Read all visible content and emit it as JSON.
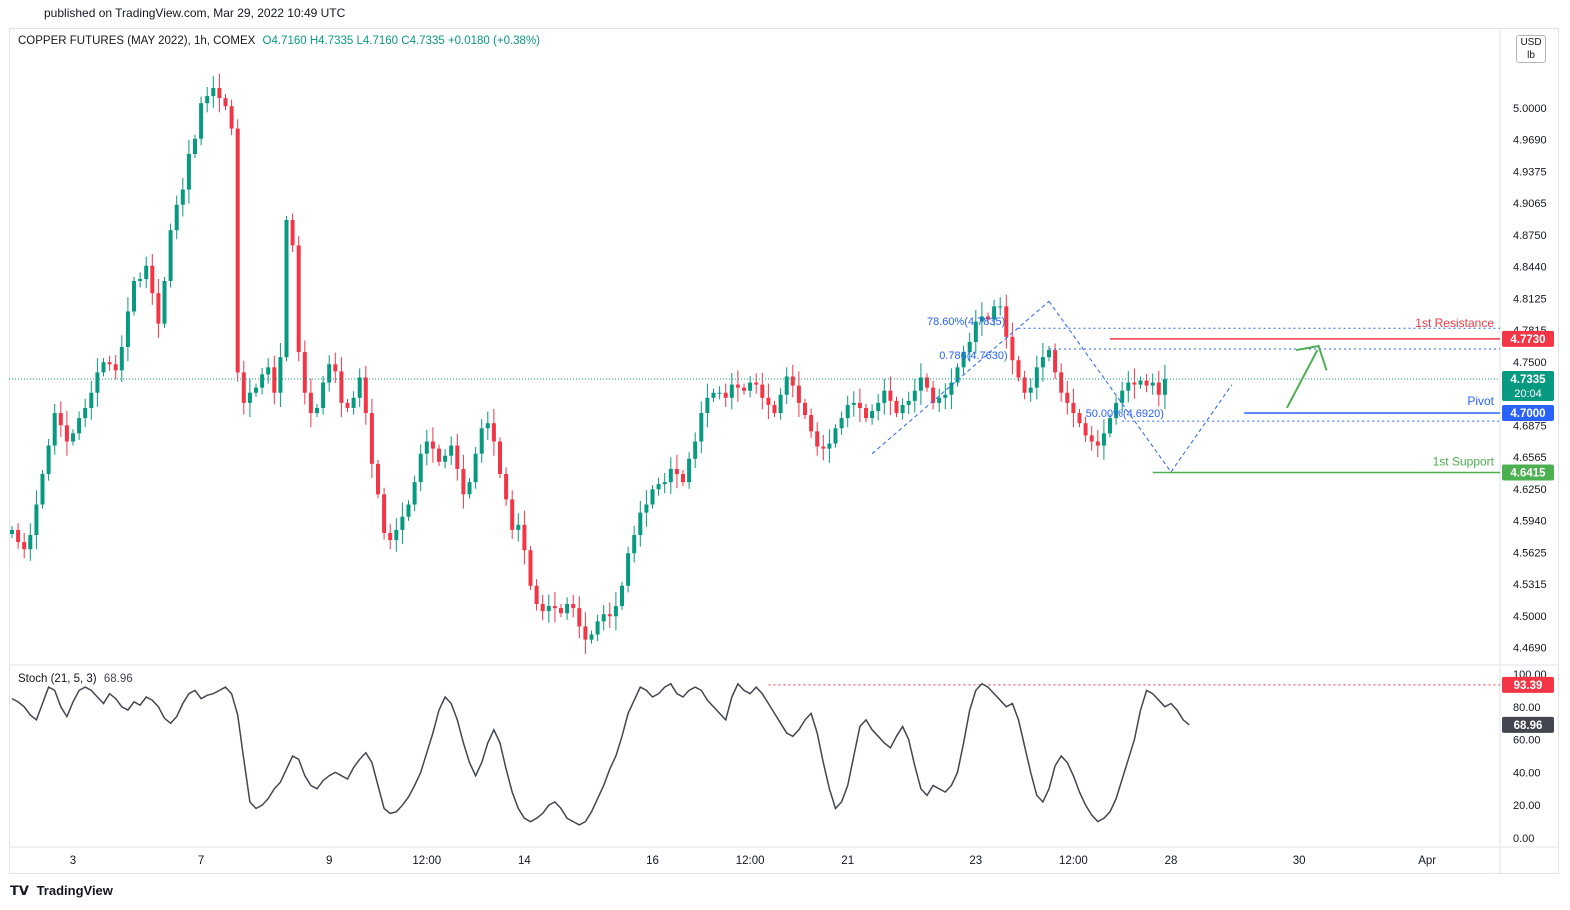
{
  "header": {
    "published": "published on TradingView.com, Mar 29, 2022 10:49 UTC"
  },
  "legend": {
    "symbol": "COPPER FUTURES (MAY 2022), 1h, COMEX",
    "ohlc": "O4.7160  H4.7335  L4.7160  C4.7335  +0.0180 (+0.38%)"
  },
  "units": {
    "currency": "USD",
    "unit": "lb"
  },
  "stoch_legend": {
    "label": "Stoch (21, 5, 3)",
    "value": "68.96"
  },
  "footer": {
    "brand": "TradingView",
    "logo_icon": "tradingview-logo-icon"
  },
  "colors": {
    "up": "#089981",
    "down": "#f23645",
    "resistance": "#f23645",
    "pivot": "#2962ff",
    "support": "#4caf50",
    "stoch": "#434651"
  },
  "chart_data": [
    {
      "type": "candlestick",
      "title": "COPPER FUTURES (MAY 2022), 1h, COMEX",
      "ylim": [
        4.453,
        5.078
      ],
      "price_ticks": [
        "5.0000",
        "4.9690",
        "4.9375",
        "4.9065",
        "4.8750",
        "4.8440",
        "4.8125",
        "4.7815",
        "4.7500",
        "4.6875",
        "4.6565",
        "4.6250",
        "4.5940",
        "4.5625",
        "4.5315",
        "4.5000",
        "4.4690"
      ],
      "x_ticks": [
        {
          "label": "3",
          "i": 10
        },
        {
          "label": "7",
          "i": 31
        },
        {
          "label": "9",
          "i": 52
        },
        {
          "label": "12:00",
          "i": 68
        },
        {
          "label": "14",
          "i": 84
        },
        {
          "label": "16",
          "i": 105
        },
        {
          "label": "12:00",
          "i": 121
        },
        {
          "label": "21",
          "i": 137
        },
        {
          "label": "23",
          "i": 158
        },
        {
          "label": "12:00",
          "i": 174
        },
        {
          "label": "28",
          "i": 190
        },
        {
          "label": "30",
          "i": 211
        },
        {
          "label": "Apr",
          "i": 232
        }
      ],
      "series_close": [
        4.585,
        4.573,
        4.566,
        4.58,
        4.61,
        4.64,
        4.668,
        4.7,
        4.688,
        4.672,
        4.68,
        4.695,
        4.705,
        4.72,
        4.74,
        4.75,
        4.748,
        4.742,
        4.765,
        4.8,
        4.83,
        4.832,
        4.845,
        4.818,
        4.788,
        4.83,
        4.88,
        4.905,
        4.92,
        4.955,
        4.97,
        5.005,
        5.012,
        5.02,
        5.01,
        5.002,
        4.98,
        4.74,
        4.71,
        4.72,
        4.725,
        4.738,
        4.745,
        4.72,
        4.755,
        4.89,
        4.865,
        4.76,
        4.72,
        4.7,
        4.705,
        4.73,
        4.748,
        4.741,
        4.71,
        4.705,
        4.715,
        4.735,
        4.7,
        4.65,
        4.62,
        4.582,
        4.575,
        4.585,
        4.598,
        4.61,
        4.632,
        4.66,
        4.672,
        4.665,
        4.652,
        4.658,
        4.668,
        4.645,
        4.62,
        4.632,
        4.66,
        4.685,
        4.69,
        4.672,
        4.64,
        4.615,
        4.585,
        4.59,
        4.565,
        4.53,
        4.512,
        4.505,
        4.51,
        4.508,
        4.503,
        4.512,
        4.508,
        4.49,
        4.477,
        4.482,
        4.495,
        4.502,
        4.5,
        4.51,
        4.53,
        4.562,
        4.58,
        4.602,
        4.61,
        4.625,
        4.63,
        4.632,
        4.645,
        4.64,
        4.632,
        4.655,
        4.672,
        4.7,
        4.715,
        4.72,
        4.72,
        4.715,
        4.728,
        4.725,
        4.722,
        4.73,
        4.728,
        4.715,
        4.708,
        4.7,
        4.718,
        4.736,
        4.727,
        4.71,
        4.698,
        4.682,
        4.667,
        4.665,
        4.67,
        4.685,
        4.695,
        4.708,
        4.71,
        4.705,
        4.695,
        4.702,
        4.71,
        4.722,
        4.712,
        4.7,
        4.708,
        4.712,
        4.722,
        4.735,
        4.725,
        4.71,
        4.715,
        4.718,
        4.73,
        4.745,
        4.76,
        4.77,
        4.79,
        4.795,
        4.792,
        4.805,
        4.805,
        4.775,
        4.752,
        4.735,
        4.72,
        4.725,
        4.745,
        4.755,
        4.762,
        4.74,
        4.72,
        4.71,
        4.7,
        4.69,
        4.678,
        4.672,
        4.668,
        4.68,
        4.695,
        4.71,
        4.722,
        4.73,
        4.728,
        4.732,
        4.727,
        4.73,
        4.718,
        4.7335
      ],
      "annotations": {
        "resistance": {
          "label": "1st Resistance",
          "price": "4.7730"
        },
        "pivot": {
          "label": "Pivot",
          "price": "4.7000"
        },
        "support": {
          "label": "1st Support",
          "price": "4.6415"
        },
        "last_price": {
          "price": "4.7335",
          "countdown": "20:04"
        },
        "fib_upper": [
          "78.60%(4.7835)",
          "0.786(4.7630)"
        ],
        "fib_lower": "50.00%(4.6920)"
      }
    },
    {
      "type": "line",
      "title": "Stoch (21, 5, 3)",
      "ylim": [
        0,
        100
      ],
      "y_ticks": [
        "100.00",
        "80.00",
        "60.00",
        "40.00",
        "20.00",
        "0.00"
      ],
      "levels": {
        "last": "68.96",
        "upper": "93.39"
      },
      "values": [
        85,
        83,
        80,
        75,
        72,
        82,
        92,
        90,
        80,
        74,
        83,
        90,
        92,
        90,
        86,
        82,
        88,
        85,
        80,
        78,
        83,
        81,
        86,
        84,
        80,
        73,
        70,
        74,
        82,
        88,
        90,
        85,
        87,
        88,
        90,
        92,
        88,
        75,
        48,
        22,
        18,
        20,
        24,
        30,
        34,
        42,
        50,
        48,
        38,
        32,
        30,
        35,
        38,
        40,
        38,
        36,
        43,
        48,
        52,
        46,
        32,
        18,
        15,
        16,
        20,
        25,
        32,
        40,
        52,
        64,
        78,
        86,
        82,
        72,
        58,
        46,
        38,
        46,
        58,
        66,
        58,
        42,
        28,
        18,
        12,
        10,
        12,
        15,
        20,
        22,
        18,
        12,
        10,
        8,
        10,
        16,
        24,
        32,
        42,
        50,
        62,
        76,
        84,
        92,
        90,
        86,
        88,
        92,
        94,
        88,
        86,
        90,
        92,
        90,
        84,
        80,
        76,
        72,
        86,
        94,
        90,
        88,
        92,
        88,
        82,
        76,
        70,
        64,
        62,
        66,
        72,
        76,
        64,
        46,
        30,
        18,
        22,
        32,
        50,
        68,
        72,
        66,
        62,
        58,
        55,
        62,
        68,
        60,
        44,
        30,
        26,
        32,
        30,
        28,
        32,
        40,
        58,
        78,
        90,
        94,
        92,
        88,
        84,
        80,
        82,
        72,
        56,
        40,
        26,
        22,
        30,
        44,
        50,
        46,
        38,
        28,
        20,
        14,
        10,
        12,
        16,
        24,
        36,
        48,
        60,
        78,
        90,
        88,
        84,
        80,
        82,
        78,
        72,
        68.96
      ]
    }
  ]
}
